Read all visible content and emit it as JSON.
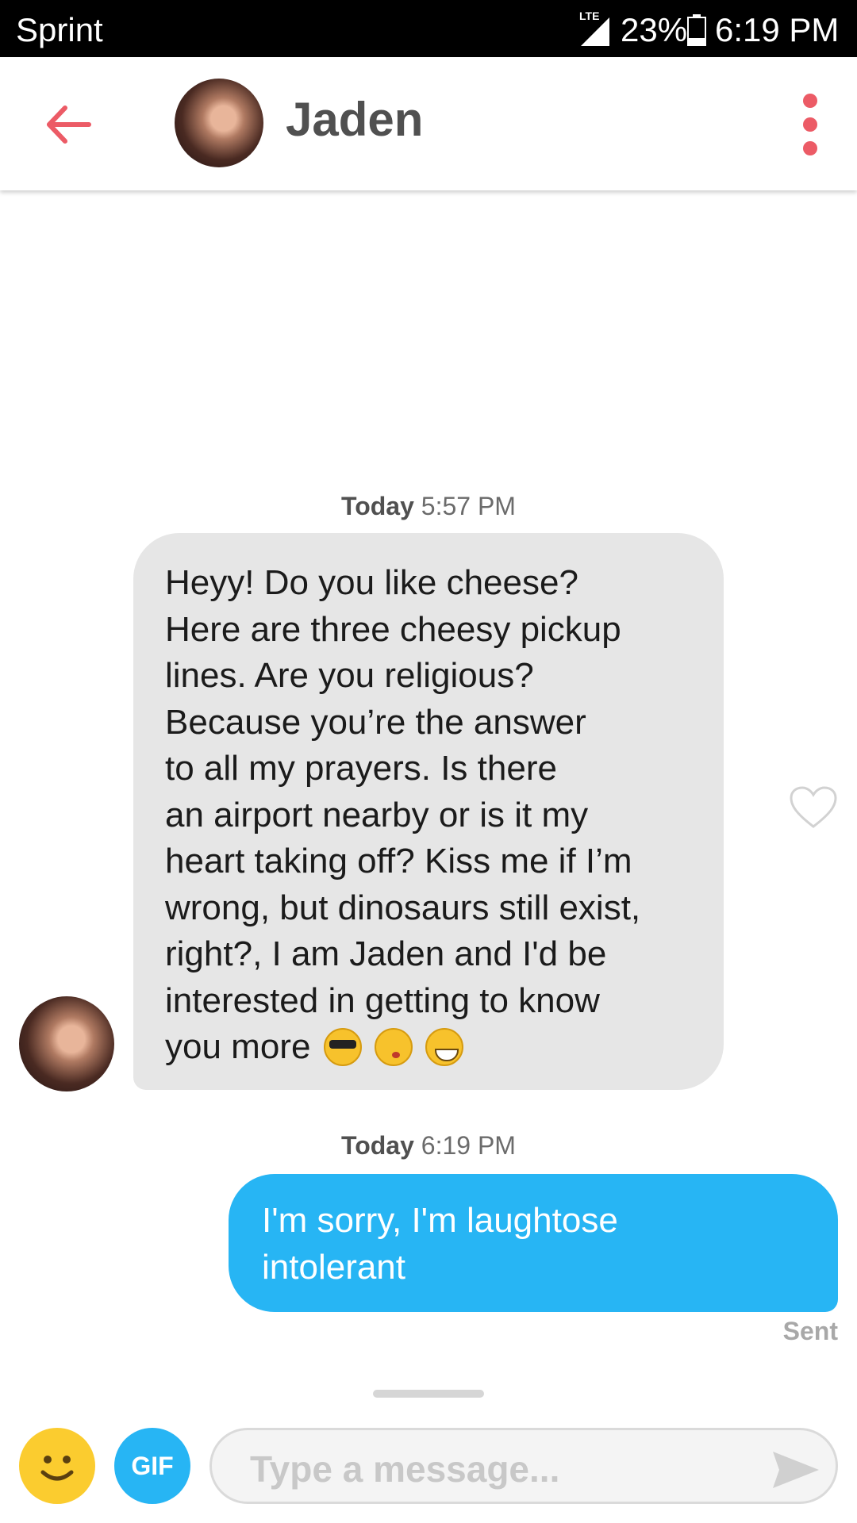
{
  "status_bar": {
    "carrier": "Sprint",
    "network": "LTE",
    "battery": "23%",
    "time": "6:19 PM"
  },
  "header": {
    "contact_name": "Jaden",
    "back_icon": "arrow-left-icon",
    "menu_icon": "more-vertical-icon"
  },
  "messages": [
    {
      "timestamp_day": "Today",
      "timestamp_time": "5:57 PM",
      "direction": "incoming",
      "lines": [
        "Heyy! Do you like cheese?",
        "Here are three cheesy pickup",
        "lines. Are you religious?",
        "Because you’re the answer",
        "to all my prayers. Is there",
        "an airport nearby or is it my",
        "heart taking off? Kiss me if I’m",
        "wrong, but dinosaurs still exist,",
        "right?, I am Jaden and I'd be",
        "interested in getting to know",
        "you more"
      ],
      "emojis": [
        "smiling-face-sunglasses-icon",
        "kissing-face-icon",
        "grinning-face-icon"
      ]
    },
    {
      "timestamp_day": "Today",
      "timestamp_time": "6:19 PM",
      "direction": "outgoing",
      "lines": [
        "I'm sorry, I'm laughtose",
        "intolerant"
      ],
      "status": "Sent"
    }
  ],
  "composer": {
    "gif_label": "GIF",
    "placeholder": "Type a message..."
  },
  "colors": {
    "accent_red": "#ec5b66",
    "outgoing_bubble": "#27b5f4",
    "incoming_bubble": "#e6e6e6",
    "emoji_button": "#fbcc2f"
  }
}
